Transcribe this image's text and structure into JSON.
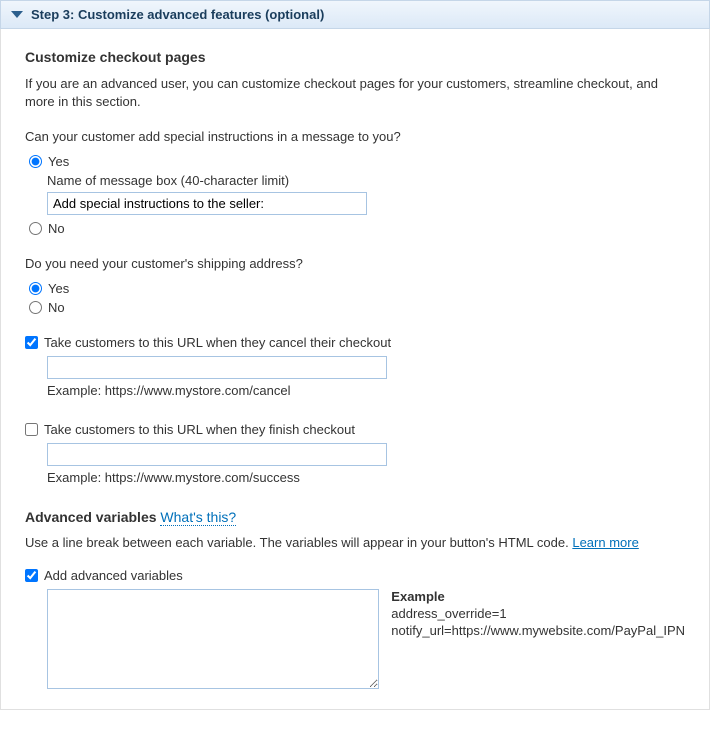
{
  "header": {
    "title": "Step 3: Customize advanced features (optional)"
  },
  "checkout": {
    "heading": "Customize checkout pages",
    "description": "If you are an advanced user, you can customize checkout pages for your customers, streamline checkout, and more in this section.",
    "special_instructions": {
      "question": "Can your customer add special instructions in a message to you?",
      "yes_label": "Yes",
      "no_label": "No",
      "msg_box_label": "Name of message box (40-character limit)",
      "msg_box_value": "Add special instructions to the seller:"
    },
    "shipping": {
      "question": "Do you need your customer's shipping address?",
      "yes_label": "Yes",
      "no_label": "No"
    },
    "cancel_url": {
      "label": "Take customers to this URL when they cancel their checkout",
      "value": "",
      "example": "Example: https://www.mystore.com/cancel"
    },
    "finish_url": {
      "label": "Take customers to this URL when they finish checkout",
      "value": "",
      "example": "Example: https://www.mystore.com/success"
    }
  },
  "advanced": {
    "heading": "Advanced variables",
    "whats_this": "What's this?",
    "description": "Use a line break between each variable. The variables will appear in your button's HTML code. ",
    "learn_more": "Learn more",
    "checkbox_label": "Add advanced variables",
    "textarea_value": "",
    "example": {
      "title": "Example",
      "line1": "address_override=1",
      "line2": "notify_url=https://www.mywebsite.com/PayPal_IPN"
    }
  }
}
